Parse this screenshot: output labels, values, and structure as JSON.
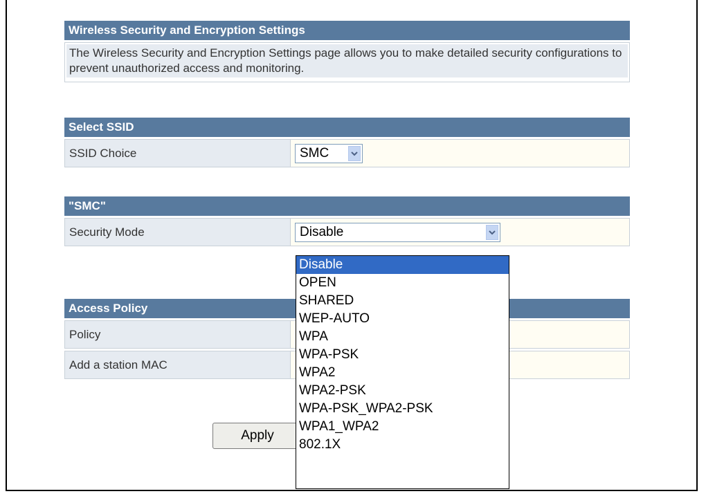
{
  "section_wireless": {
    "title": "Wireless Security and Encryption Settings",
    "description": "The Wireless Security and Encryption Settings page allows you to make detailed security configurations to prevent unauthorized access and monitoring."
  },
  "section_ssid": {
    "title": "Select SSID",
    "ssid_label": "SSID Choice",
    "ssid_value": "SMC"
  },
  "section_smc": {
    "title": "\"SMC\"",
    "security_label": "Security Mode",
    "security_value": "Disable",
    "options": [
      "Disable",
      "OPEN",
      "SHARED",
      "WEP-AUTO",
      "WPA",
      "WPA-PSK",
      "WPA2",
      "WPA2-PSK",
      "WPA-PSK_WPA2-PSK",
      "WPA1_WPA2",
      "802.1X"
    ]
  },
  "section_access": {
    "title": "Access Policy",
    "policy_label": "Policy",
    "mac_label": "Add a station MAC"
  },
  "apply_label": "Apply"
}
